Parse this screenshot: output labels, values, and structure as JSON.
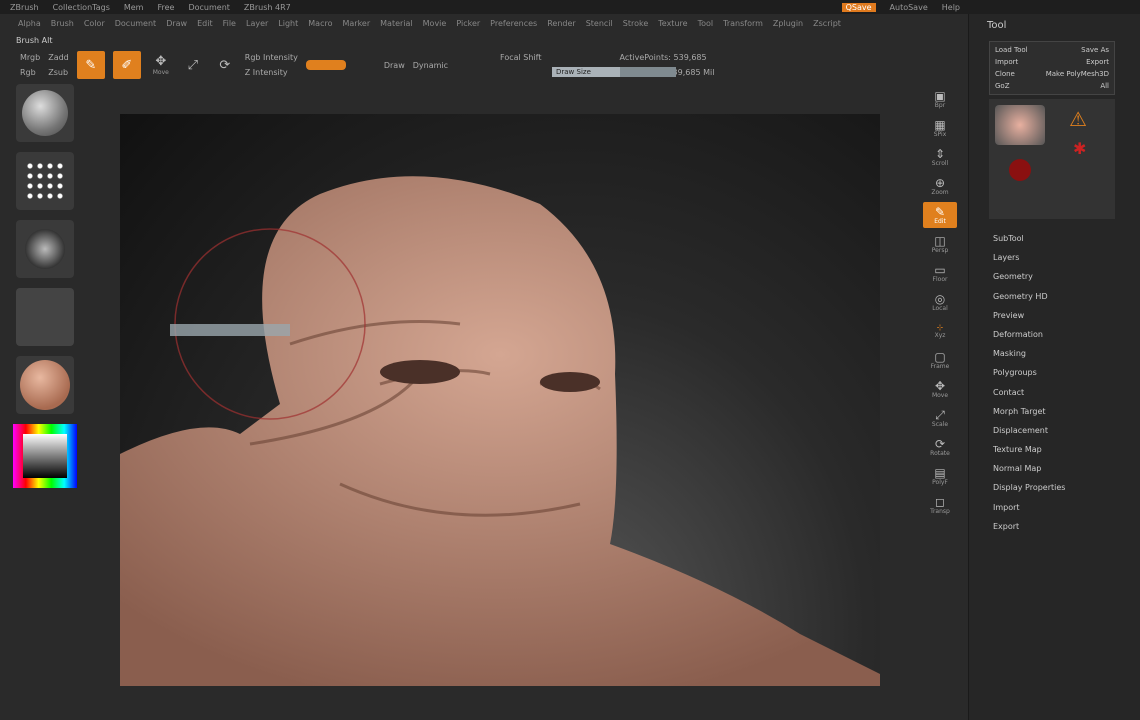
{
  "title": {
    "segments": [
      "ZBrush",
      "CollectionTags",
      "Mem",
      "Free",
      "Document",
      "ZBrush 4R7"
    ],
    "quicksave": "QSave",
    "menus_right": [
      "AutoSave",
      "Help"
    ]
  },
  "menubar": [
    "Alpha",
    "Brush",
    "Color",
    "Document",
    "Draw",
    "Edit",
    "File",
    "Layer",
    "Light",
    "Macro",
    "Marker",
    "Material",
    "Movie",
    "Picker",
    "Preferences",
    "Render",
    "Stencil",
    "Stroke",
    "Texture",
    "Tool",
    "Transform",
    "Zplugin",
    "Zscript"
  ],
  "brush_label": "Brush Alt",
  "toolbar": {
    "mrgb": "Mrgb",
    "rgb": "Rgb",
    "zadd": "Zadd",
    "zsub": "Zsub",
    "draw_label": "Draw",
    "edit_label": "Edit",
    "move_label": "Move",
    "rgb_intensity": "Rgb Intensity",
    "z_intensity": "Z Intensity",
    "focal_shift": "Focal Shift",
    "draw_size": "Draw Size",
    "dynamic": "Dynamic",
    "active_points": "ActivePoints: 539,685",
    "total_points": "TotalPoints: 539,685 Mil",
    "z_intensity_value": 0.45
  },
  "left_shelf": [
    "Standard brush",
    "DragRect stroke",
    "Alpha",
    "Texture off",
    "Material",
    "Color picker"
  ],
  "right_shelf": [
    "Bpr",
    "SPix",
    "Scroll",
    "Zoom",
    "Edit",
    "Persp",
    "Floor",
    "Local",
    "Xyz",
    "Frame",
    "Move",
    "Scale",
    "Rotate",
    "PolyF",
    "Transp"
  ],
  "tray": {
    "title": "Tool",
    "grid": [
      [
        "Load Tool",
        "Save As"
      ],
      [
        "Import",
        "Export"
      ],
      [
        "Clone",
        "Make PolyMesh3D"
      ],
      [
        "GoZ",
        "All"
      ]
    ],
    "items": [
      "SubTool",
      "Layers",
      "Geometry",
      "Geometry HD",
      "Preview",
      "Deformation",
      "Masking",
      "Polygroups",
      "Contact",
      "Morph Target",
      "Displacement",
      "Texture Map",
      "Normal Map",
      "Display Properties",
      "Import",
      "Export"
    ]
  },
  "colors": {
    "accent": "#e0801e",
    "background": "#2a2a2a",
    "skin": "#c89a86"
  }
}
